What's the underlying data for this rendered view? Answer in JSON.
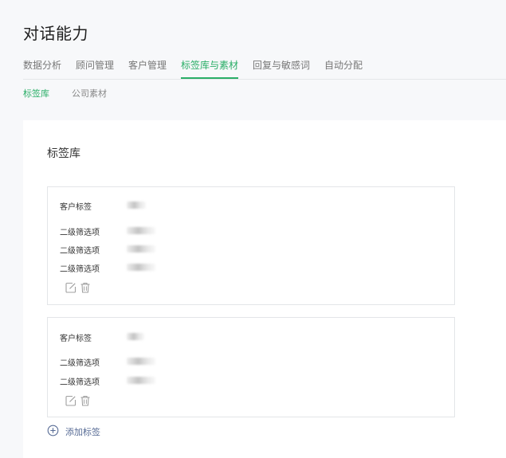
{
  "page": {
    "title": "对话能力"
  },
  "tabs": [
    {
      "label": "数据分析",
      "active": false
    },
    {
      "label": "顾问管理",
      "active": false
    },
    {
      "label": "客户管理",
      "active": false
    },
    {
      "label": "标签库与素材",
      "active": true
    },
    {
      "label": "回复与敏感词",
      "active": false
    },
    {
      "label": "自动分配",
      "active": false
    }
  ],
  "subtabs": [
    {
      "label": "标签库",
      "active": true
    },
    {
      "label": "公司素材",
      "active": false
    }
  ],
  "panel": {
    "title": "标签库",
    "cards": [
      {
        "tag_label": "客户标签",
        "filter_label": "二级筛选项",
        "filter_count": 3
      },
      {
        "tag_label": "客户标签",
        "filter_label": "二级筛选项",
        "filter_count": 2
      }
    ],
    "add_tag_label": "添加标签"
  },
  "colors": {
    "accent": "#2aae67",
    "link": "#576b95",
    "icon": "#a0a0a0"
  },
  "icons": {
    "edit": "edit-icon",
    "delete": "trash-icon",
    "add": "plus-circle-icon"
  }
}
